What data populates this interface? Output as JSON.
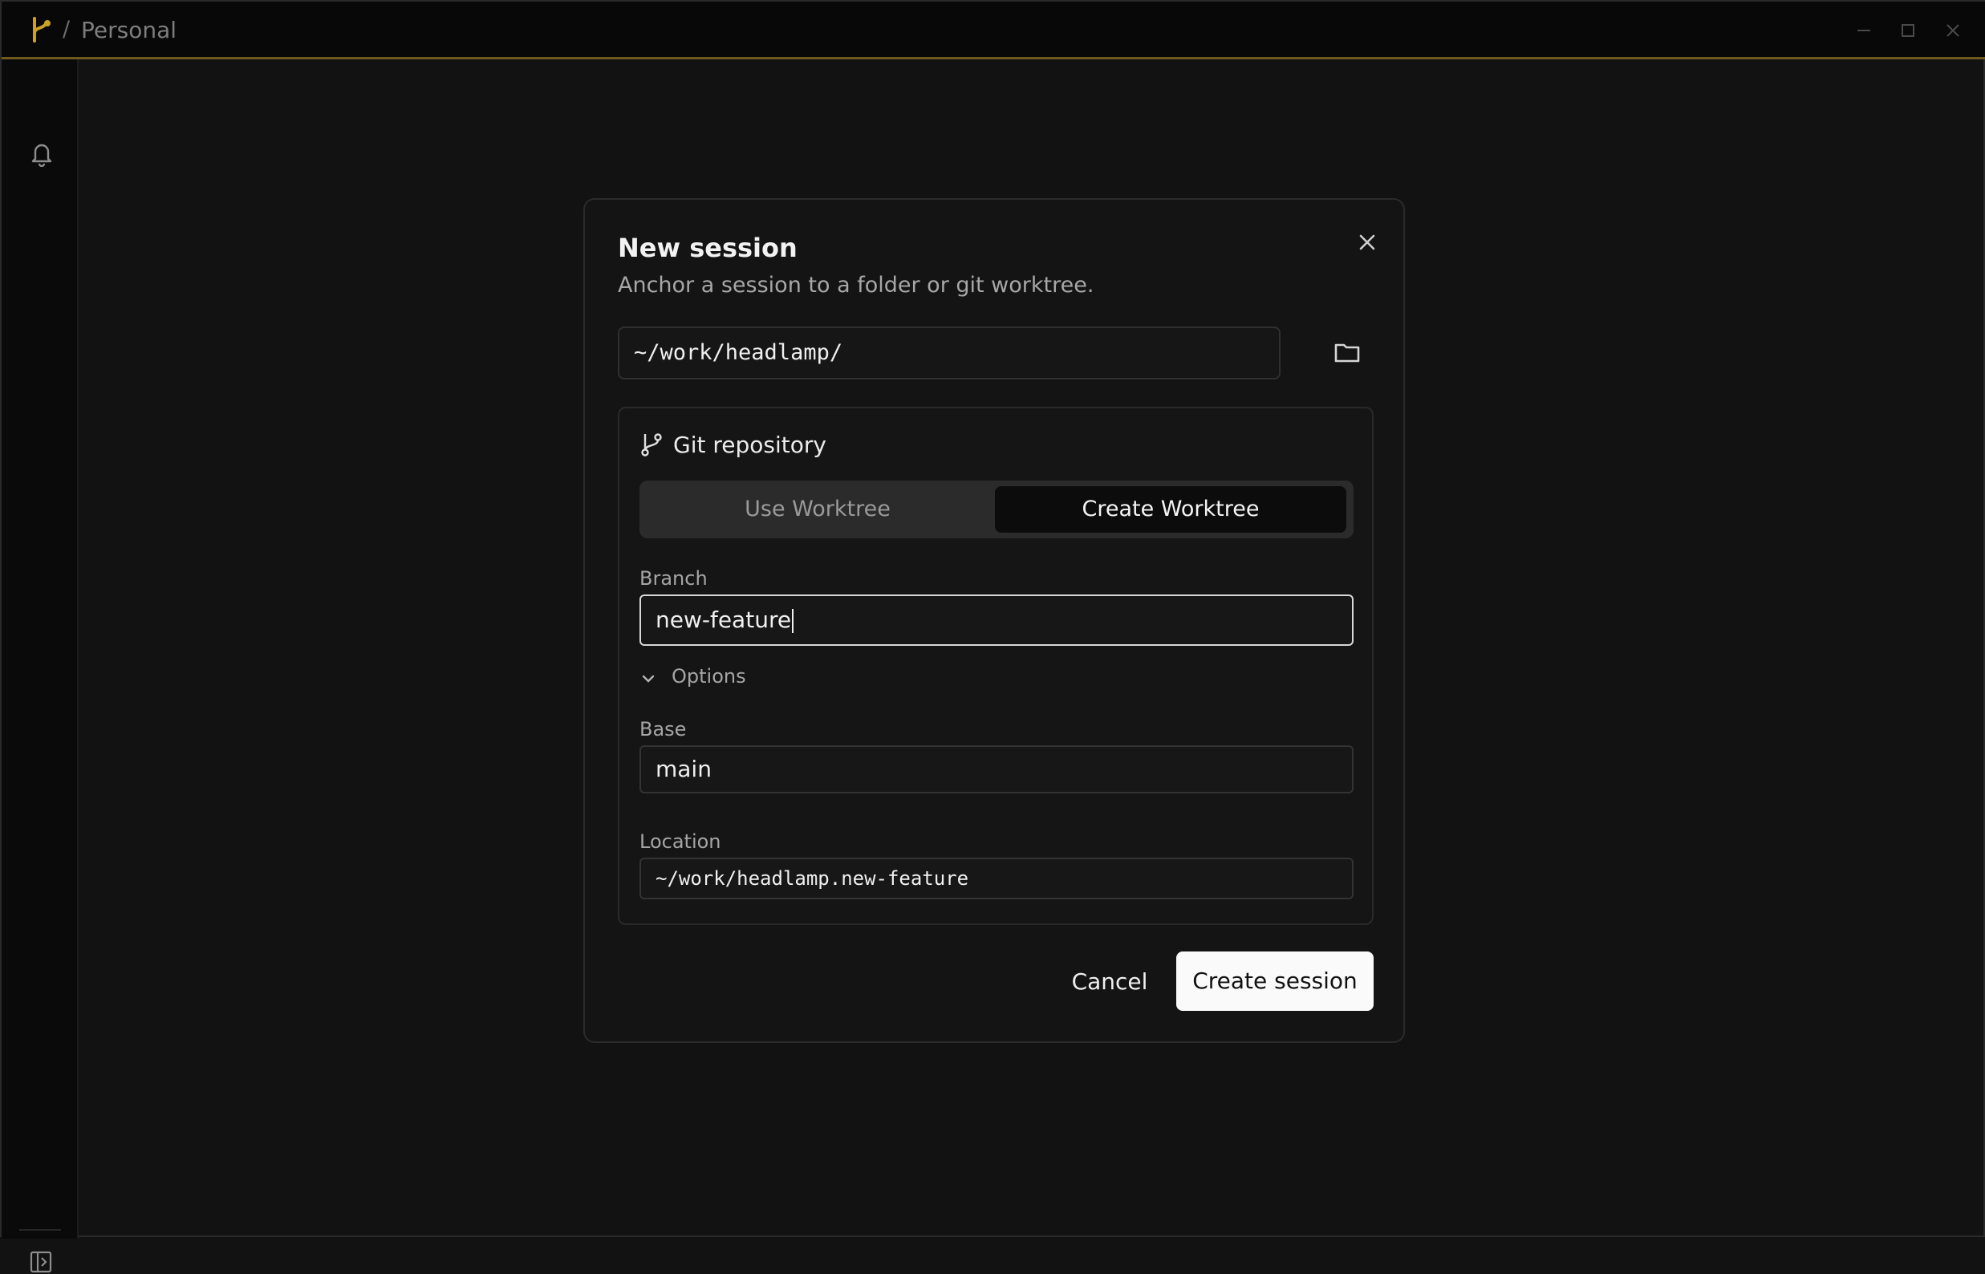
{
  "titlebar": {
    "separator": "/",
    "workspace": "Personal",
    "logo_icon": "branch-logo-icon",
    "controls": [
      "minimize-icon",
      "maximize-icon",
      "close-icon"
    ]
  },
  "sidebar": {
    "top_icon": "bell-icon",
    "bottom_icon": "panel-toggle-icon"
  },
  "dialog": {
    "title": "New session",
    "subtitle": "Anchor a session to a folder or git worktree.",
    "path_value": "~/work/headlamp/",
    "git": {
      "title": "Git repository",
      "tabs": [
        "Use Worktree",
        "Create Worktree"
      ],
      "selected_tab": "Create Worktree",
      "branch_label": "Branch",
      "branch_value": "new-feature",
      "options_label": "Options",
      "base_label": "Base",
      "base_value": "main",
      "location_label": "Location",
      "location_value": "~/work/headlamp.new-feature"
    },
    "cancel_label": "Cancel",
    "create_label": "Create session"
  },
  "colors": {
    "background": "#121212",
    "accent_border": "#6e5a1c",
    "logo": "#c9a227",
    "primary_button": "#fafafa"
  }
}
